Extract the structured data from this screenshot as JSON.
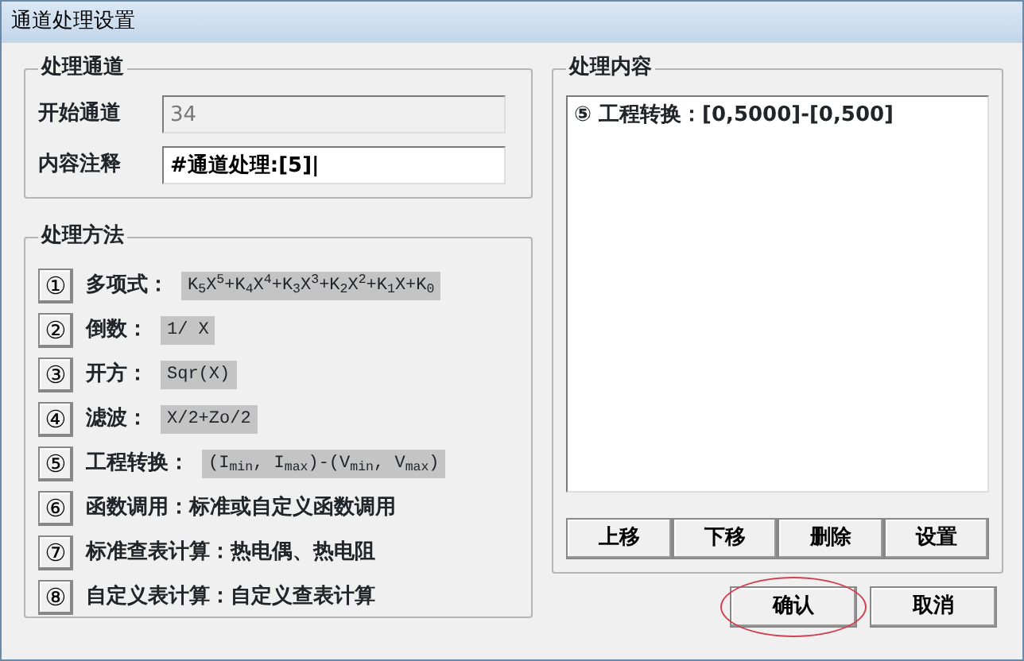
{
  "window": {
    "title": "通道处理设置"
  },
  "channel_group": {
    "title": "处理通道",
    "start_label": "开始通道",
    "start_value": "34",
    "start_disabled": true,
    "note_label": "内容注释",
    "note_value": "#通道处理:[5]|"
  },
  "methods_group": {
    "title": "处理方法",
    "methods": [
      {
        "kind": "formula",
        "number": "①",
        "label": "多项式：",
        "formula": "K$_{5}$X$^{5}$+K$_{4}$X$^{4}$+K$_{3}$X$^{3}$+K$_{2}$X$^{2}$+K$_{1}$X+K$_{0}$"
      },
      {
        "kind": "formula",
        "number": "②",
        "label": "倒数：",
        "formula": "1/ X"
      },
      {
        "kind": "formula",
        "number": "③",
        "label": "开方：",
        "formula": "Sqr(X)"
      },
      {
        "kind": "formula",
        "number": "④",
        "label": "滤波：",
        "formula": "X/2+Zo/2"
      },
      {
        "kind": "formula",
        "number": "⑤",
        "label": "工程转换：",
        "formula": "(I$_{min}$, I$_{max}$)-(V$_{min}$, V$_{max}$)"
      },
      {
        "kind": "text",
        "number": "⑥",
        "label": "函数调用：标准或自定义函数调用"
      },
      {
        "kind": "text",
        "number": "⑦",
        "label": "标准查表计算：热电偶、热电阻"
      },
      {
        "kind": "text",
        "number": "⑧",
        "label": "自定义表计算：自定义查表计算"
      }
    ]
  },
  "content_group": {
    "title": "处理内容",
    "items": [
      {
        "text": "⑤ 工程转换：[0,5000]-[0,500]",
        "selected": false
      }
    ],
    "buttons": [
      "上移",
      "下移",
      "删除",
      "设置"
    ]
  },
  "dialog_buttons": [
    {
      "label": "确认",
      "circled": true
    },
    {
      "label": "取消",
      "circled": false
    }
  ]
}
